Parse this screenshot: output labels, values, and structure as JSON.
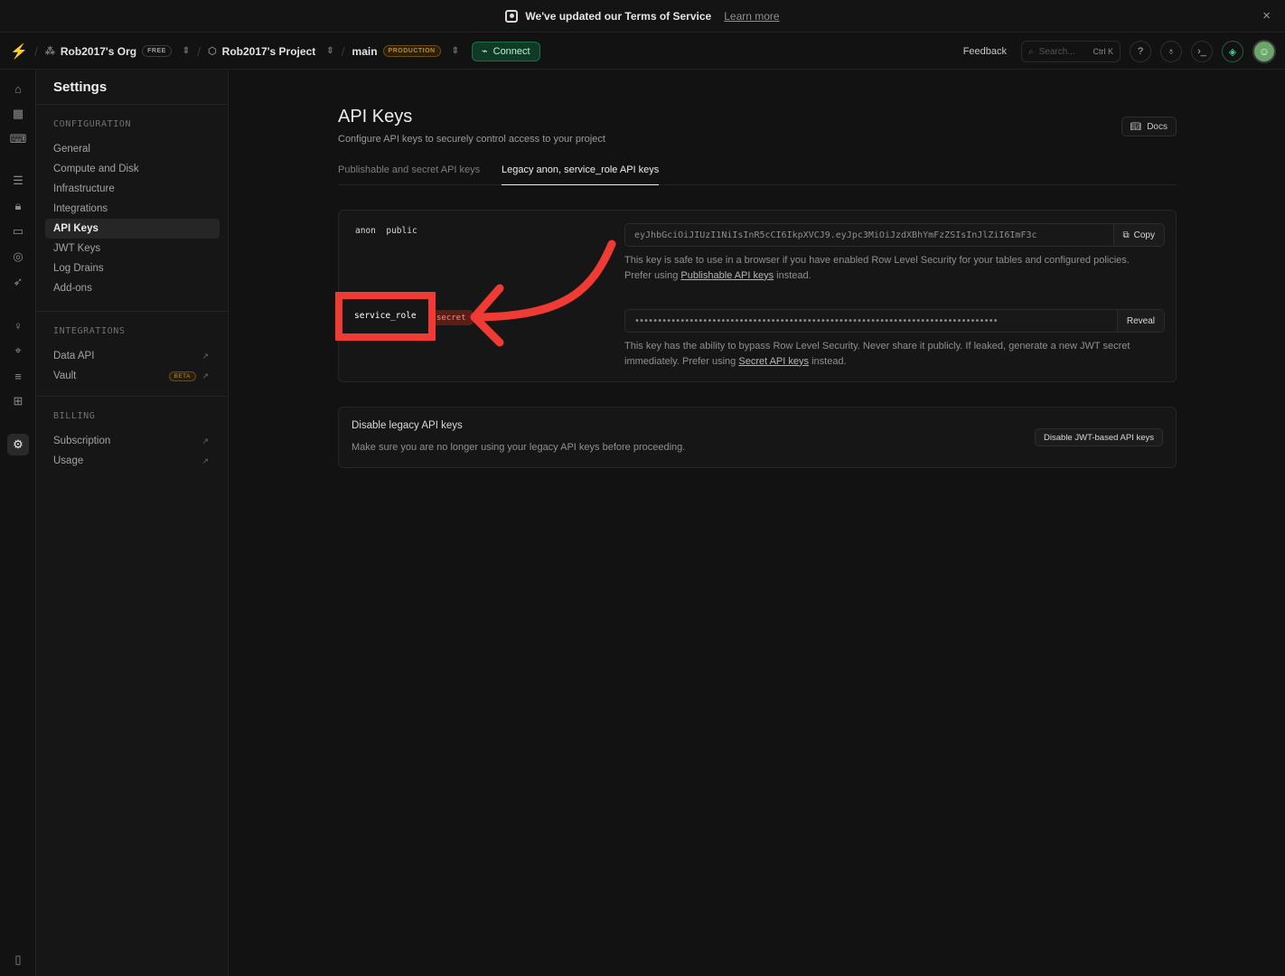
{
  "banner": {
    "text": "We've updated our Terms of Service",
    "link": "Learn more",
    "close": "×"
  },
  "topbar": {
    "org": "Rob2017's Org",
    "org_plan": "FREE",
    "project": "Rob2017's Project",
    "branch": "main",
    "branch_badge": "PRODUCTION",
    "connect": "Connect",
    "feedback": "Feedback",
    "search_placeholder": "Search...",
    "search_shortcut": "Ctrl K",
    "icons": [
      "help-icon",
      "lightbulb-icon",
      "terminal-icon",
      "assistant-icon"
    ]
  },
  "sidebar": {
    "title": "Settings",
    "configuration_heading": "CONFIGURATION",
    "configuration": [
      "General",
      "Compute and Disk",
      "Infrastructure",
      "Integrations",
      "API Keys",
      "JWT Keys",
      "Log Drains",
      "Add-ons"
    ],
    "integrations_heading": "INTEGRATIONS",
    "integrations": [
      "Data API",
      "Vault"
    ],
    "vault_badge": "BETA",
    "billing_heading": "BILLING",
    "billing": [
      "Subscription",
      "Usage"
    ],
    "ext_icon": "↗"
  },
  "main": {
    "title": "API Keys",
    "subtitle": "Configure API keys to securely control access to your project",
    "docs": "Docs",
    "tabs": [
      "Publishable and secret API keys",
      "Legacy anon, service_role API keys"
    ],
    "anon": {
      "label": "anon",
      "tag": "public",
      "value": "eyJhbGciOiJIUzI1NiIsInR5cCI6IkpXVCJ9.eyJpc3MiOiJzdXBhYmFzZSIsInJlZiI6ImF3c",
      "button": "Copy",
      "help_1": "This key is safe to use in a browser if you have enabled Row Level Security for your tables and configured policies.",
      "help_2": "Prefer using",
      "help_link": "Publishable API keys",
      "help_3": "instead."
    },
    "service": {
      "label": "service_role",
      "badge": "secret",
      "value": "••••••••••••••••••••••••••••••••••••••••••••••••••••••••••••••••••••••••••••••••",
      "button": "Reveal",
      "help_1": "This key has the ability to bypass Row Level Security. Never share it publicly. If leaked, generate a new JWT secret",
      "help_2": "immediately. Prefer using",
      "help_link": "Secret API keys",
      "help_3": "instead."
    },
    "disable": {
      "title": "Disable legacy API keys",
      "subtitle": "Make sure you are no longer using your legacy API keys before proceeding.",
      "button": "Disable JWT-based API keys"
    }
  },
  "colors": {
    "accent": "#3ecf8e",
    "annotation": "#ef3b33",
    "background": "#121212"
  }
}
